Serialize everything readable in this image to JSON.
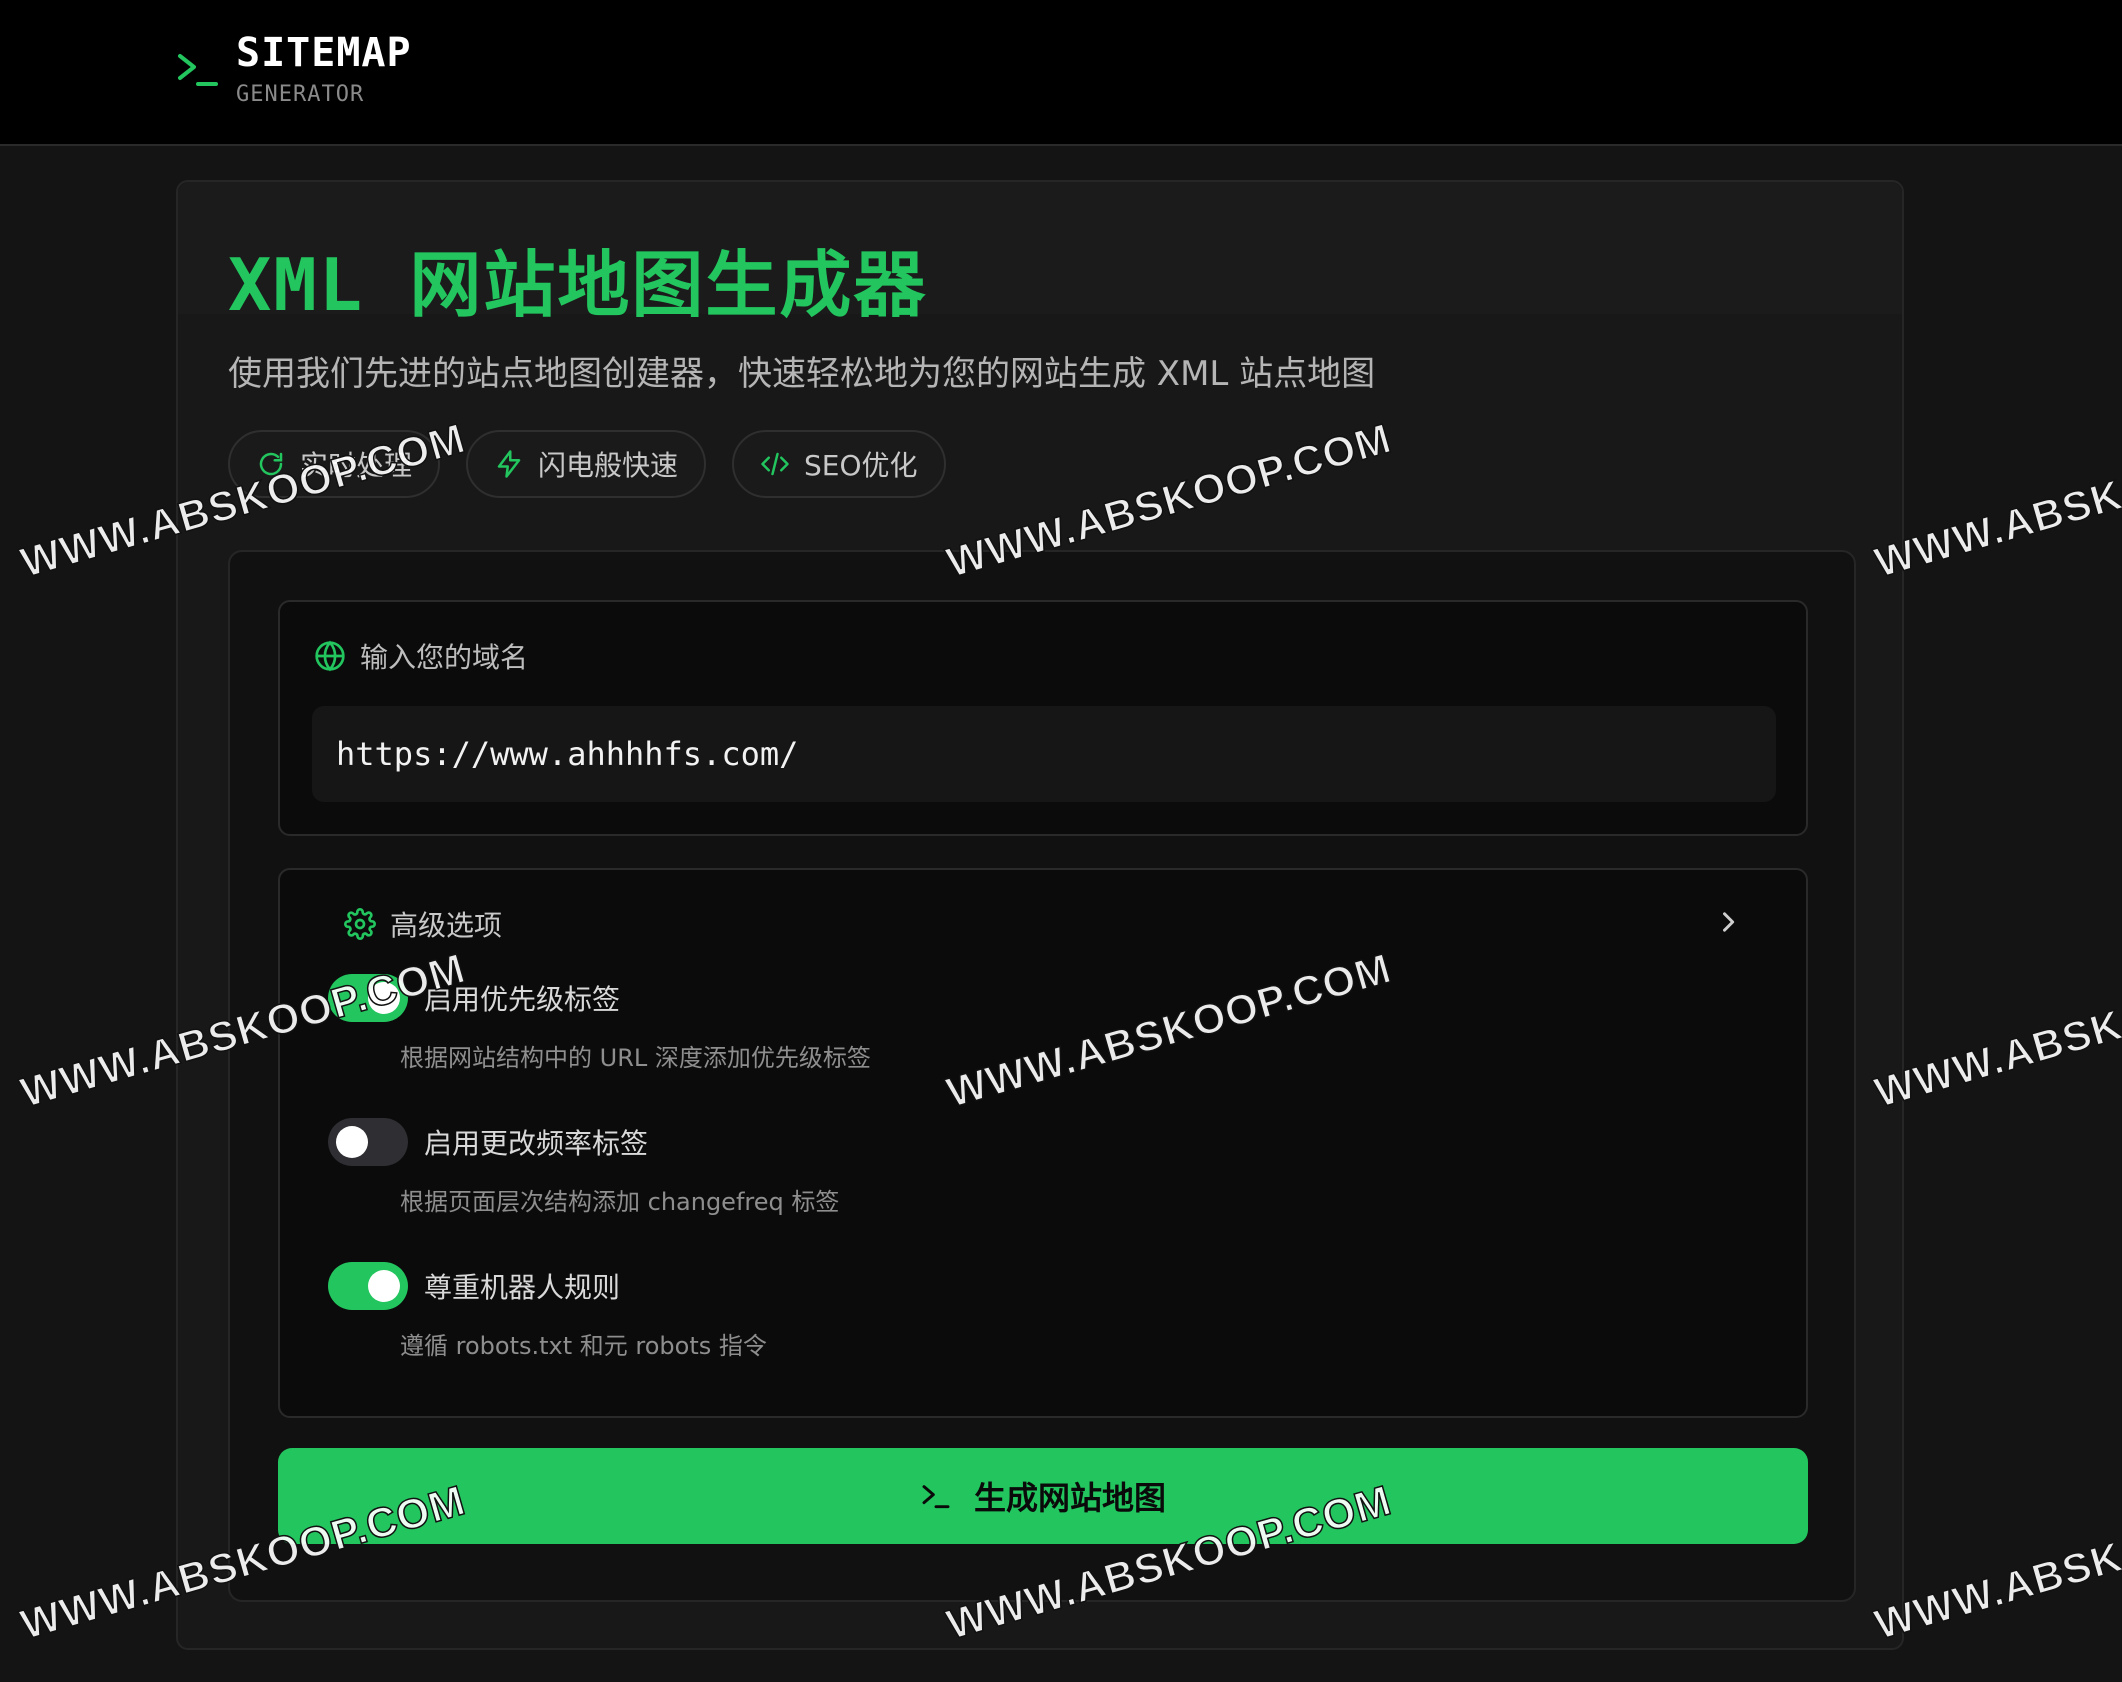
{
  "header": {
    "brand_title": "SITEMAP",
    "brand_subtitle": "GENERATOR",
    "brand_icon": "terminal-prompt-icon"
  },
  "main": {
    "title": "XML 网站地图生成器",
    "subtitle": "使用我们先进的站点地图创建器，快速轻松地为您的网站生成 XML 站点地图",
    "badges": [
      {
        "label": "实时处理",
        "icon": "refresh-icon"
      },
      {
        "label": "闪电般快速",
        "icon": "lightning-icon"
      },
      {
        "label": "SEO优化",
        "icon": "code-icon"
      }
    ]
  },
  "domain": {
    "label": "输入您的域名",
    "icon": "globe-icon",
    "value": "https://www.ahhhhfs.com/"
  },
  "advanced": {
    "title": "高级选项",
    "icon": "gear-icon",
    "options": [
      {
        "label": "启用优先级标签",
        "description": "根据网站结构中的 URL 深度添加优先级标签",
        "enabled": true
      },
      {
        "label": "启用更改频率标签",
        "description": "根据页面层次结构添加 changefreq 标签",
        "enabled": false
      },
      {
        "label": "尊重机器人规则",
        "description": "遵循 robots.txt 和元 robots 指令",
        "enabled": true
      }
    ]
  },
  "generate_button": {
    "label": "生成网站地图",
    "icon": "terminal-prompt-icon"
  },
  "watermark": "WWW.ABSKOOP.COM",
  "colors": {
    "accent": "#22c55e",
    "background": "#141414",
    "header": "#000000",
    "toggle_off": "#2e2e33"
  }
}
